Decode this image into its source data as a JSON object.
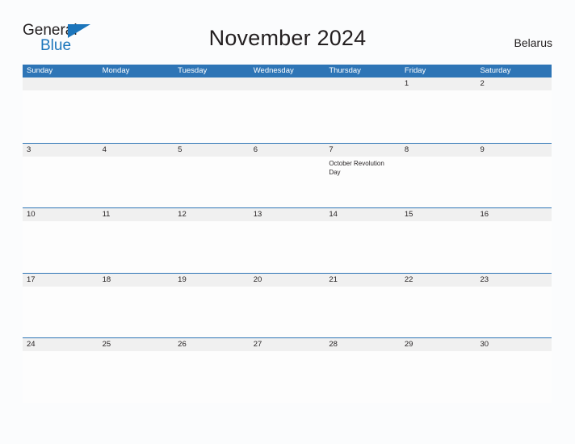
{
  "logo": {
    "word_one": "General",
    "word_two": "Blue",
    "triangle_color": "#1b75bb",
    "text_color": "#231f20"
  },
  "header": {
    "title": "November 2024",
    "country": "Belarus"
  },
  "theme": {
    "header_band": "#2e75b6",
    "date_band": "#f0f0f0",
    "page_background": "#fbfcfd",
    "text": "#231f20"
  },
  "calendar": {
    "weekdays": [
      "Sunday",
      "Monday",
      "Tuesday",
      "Wednesday",
      "Thursday",
      "Friday",
      "Saturday"
    ],
    "weeks": [
      [
        {
          "date": "",
          "events": []
        },
        {
          "date": "",
          "events": []
        },
        {
          "date": "",
          "events": []
        },
        {
          "date": "",
          "events": []
        },
        {
          "date": "",
          "events": []
        },
        {
          "date": "1",
          "events": []
        },
        {
          "date": "2",
          "events": []
        }
      ],
      [
        {
          "date": "3",
          "events": []
        },
        {
          "date": "4",
          "events": []
        },
        {
          "date": "5",
          "events": []
        },
        {
          "date": "6",
          "events": []
        },
        {
          "date": "7",
          "events": [
            "October Revolution Day"
          ]
        },
        {
          "date": "8",
          "events": []
        },
        {
          "date": "9",
          "events": []
        }
      ],
      [
        {
          "date": "10",
          "events": []
        },
        {
          "date": "11",
          "events": []
        },
        {
          "date": "12",
          "events": []
        },
        {
          "date": "13",
          "events": []
        },
        {
          "date": "14",
          "events": []
        },
        {
          "date": "15",
          "events": []
        },
        {
          "date": "16",
          "events": []
        }
      ],
      [
        {
          "date": "17",
          "events": []
        },
        {
          "date": "18",
          "events": []
        },
        {
          "date": "19",
          "events": []
        },
        {
          "date": "20",
          "events": []
        },
        {
          "date": "21",
          "events": []
        },
        {
          "date": "22",
          "events": []
        },
        {
          "date": "23",
          "events": []
        }
      ],
      [
        {
          "date": "24",
          "events": []
        },
        {
          "date": "25",
          "events": []
        },
        {
          "date": "26",
          "events": []
        },
        {
          "date": "27",
          "events": []
        },
        {
          "date": "28",
          "events": []
        },
        {
          "date": "29",
          "events": []
        },
        {
          "date": "30",
          "events": []
        }
      ]
    ]
  }
}
